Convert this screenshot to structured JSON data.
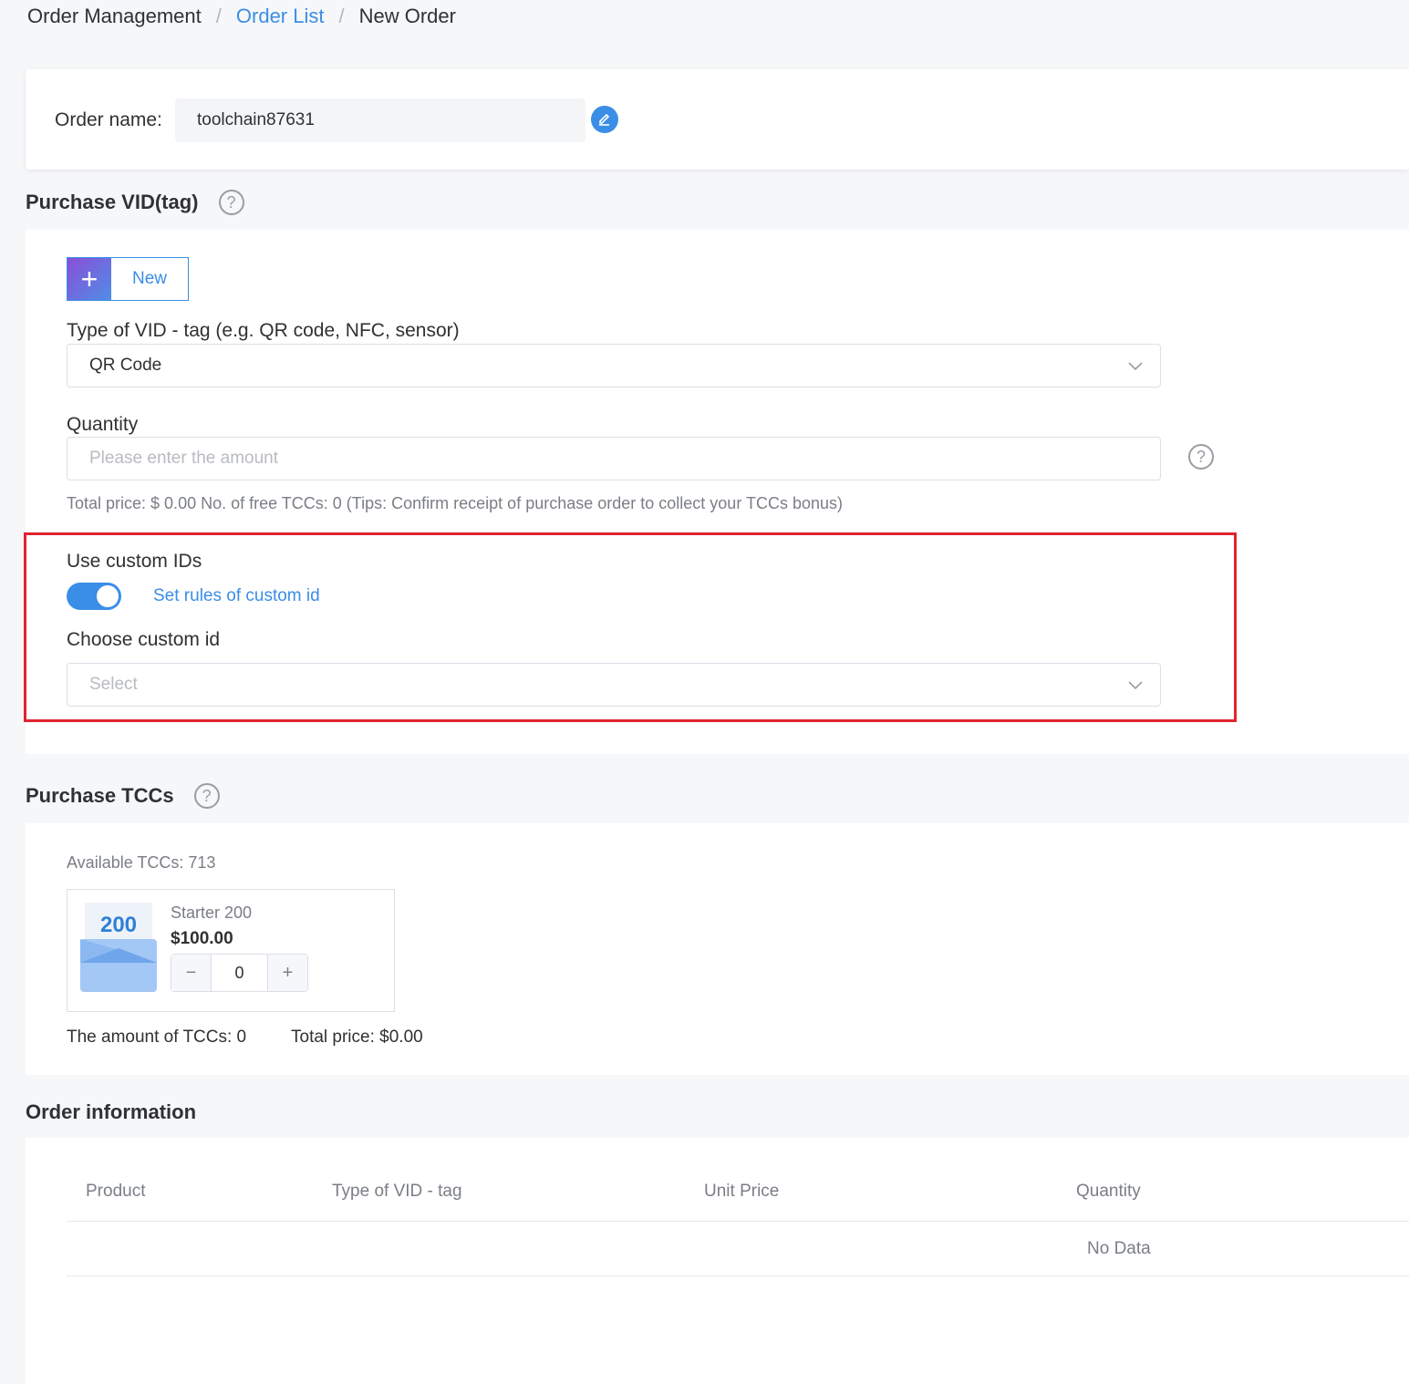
{
  "breadcrumb": {
    "items": [
      "Order Management",
      "Order List",
      "New Order"
    ],
    "separator": "/"
  },
  "order_name": {
    "label": "Order name:",
    "value": "toolchain87631"
  },
  "vid_section": {
    "title": "Purchase VID(tag)",
    "help": "?",
    "new_button": {
      "icon": "+",
      "label": "New"
    },
    "type_label": "Type of VID - tag   (e.g. QR code, NFC, sensor)",
    "type_value": "QR Code",
    "quantity_label": "Quantity",
    "quantity_placeholder": "Please enter the amount",
    "quantity_help": "?",
    "total_line": "Total price: $ 0.00  No. of free TCCs: 0 (Tips: Confirm receipt of purchase order to collect your TCCs bonus)",
    "custom_ids_label": "Use custom IDs",
    "custom_ids_enabled": true,
    "custom_rules_link": "Set rules of custom id",
    "choose_custom_label": "Choose custom id",
    "choose_custom_placeholder": "Select"
  },
  "tcc_section": {
    "title": "Purchase TCCs",
    "help": "?",
    "available": "Available TCCs: 713",
    "package": {
      "badge": "200",
      "name": "Starter 200",
      "price": "$100.00",
      "minus": "−",
      "quantity": "0",
      "plus": "+"
    },
    "amount_text": "The amount of TCCs: 0",
    "total_text": "Total price: $0.00"
  },
  "order_info": {
    "title": "Order information",
    "columns": [
      "Product",
      "Type of VID - tag",
      "Unit Price",
      "Quantity"
    ],
    "empty_text": "No Data"
  },
  "colors": {
    "accent": "#3a8ee6",
    "highlight_border": "#e0242f",
    "background": "#f6f7f9"
  }
}
